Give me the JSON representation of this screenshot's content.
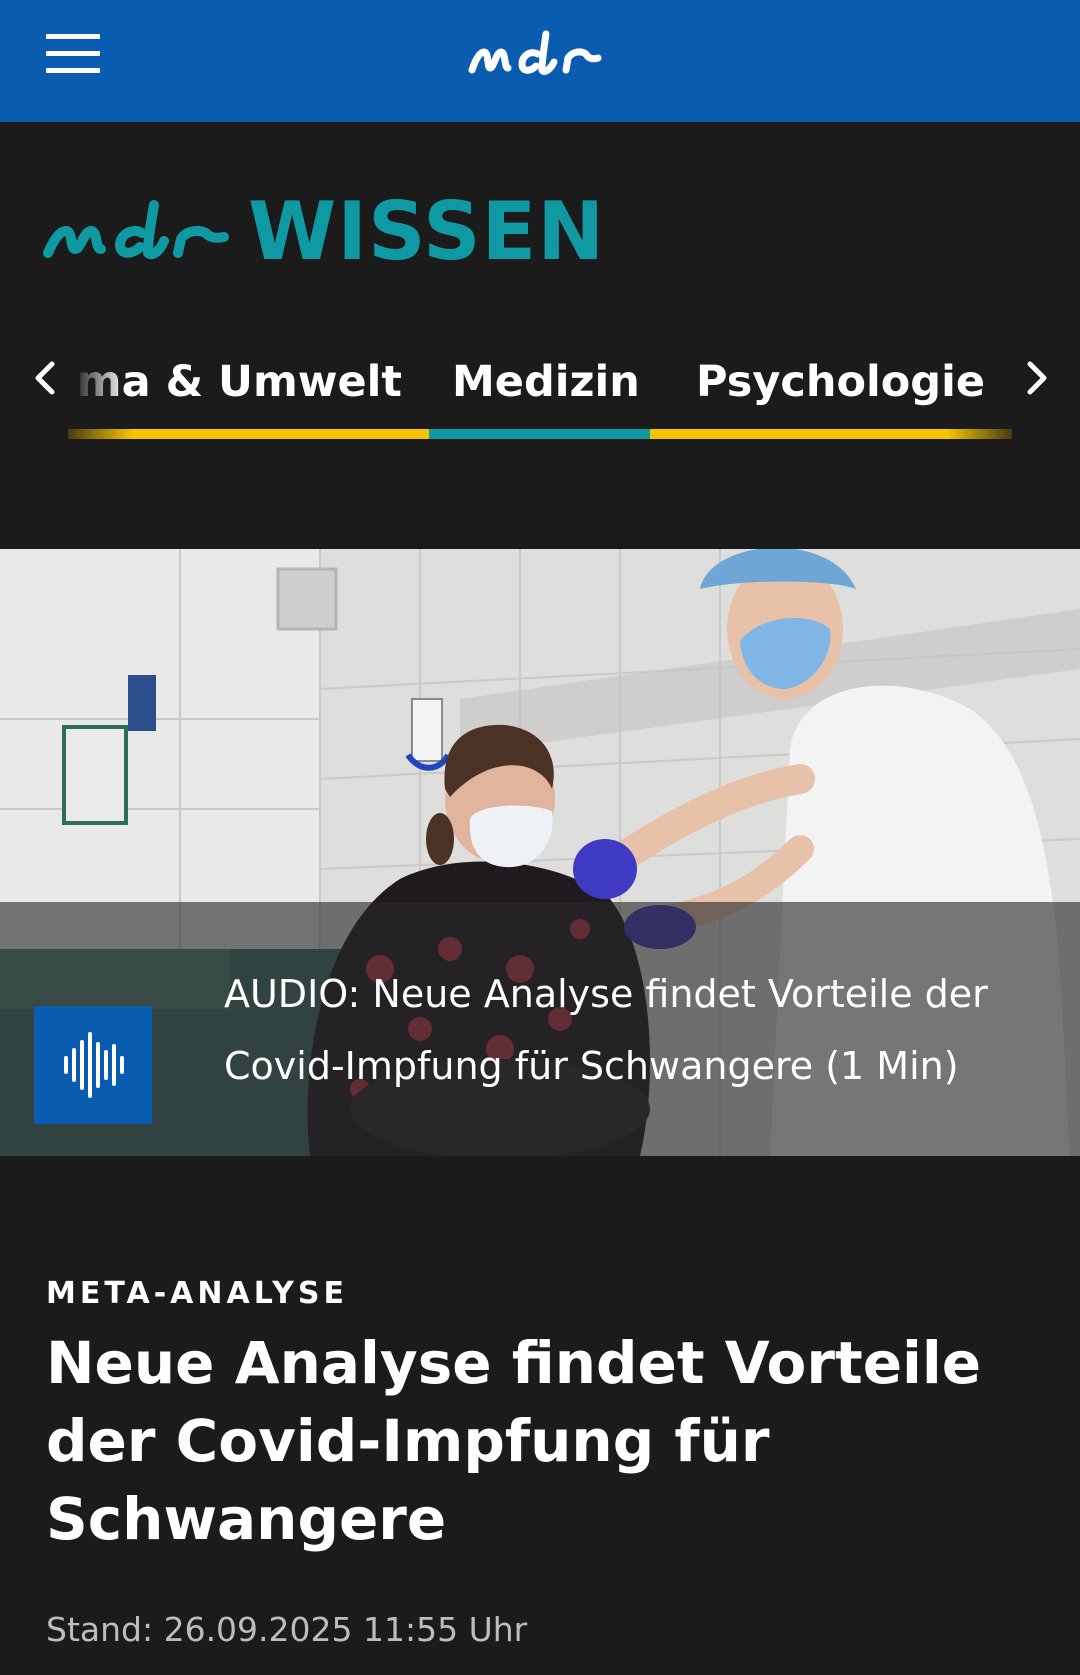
{
  "header": {
    "menu_icon": "hamburger-menu-icon",
    "logo_text": "mdr",
    "bar_color": "#0a5cb0"
  },
  "brand": {
    "logo_text": "mdr",
    "wordmark": "WISSEN",
    "color": "#0f9aa3"
  },
  "nav": {
    "prev_icon": "chevron-left-icon",
    "next_icon": "chevron-right-icon",
    "tabs": [
      {
        "label": "Klima & Umwelt",
        "active": false
      },
      {
        "label": "Medizin",
        "active": true
      },
      {
        "label": "Psychologie",
        "active": false
      }
    ],
    "active_color": "#0f9aa3",
    "inactive_color": "#f5c400"
  },
  "hero": {
    "audio_icon": "audio-waveform-icon",
    "audio_caption": "AUDIO: Neue Analyse findet Vorteile der Covid-Impfung für Schwangere (1 Min)"
  },
  "article": {
    "kicker": "META-ANALYSE",
    "headline": "Neue Analyse findet Vorteile der Covid-Impfung für Schwangere",
    "timestamp": "Stand: 26.09.2025 11:55 Uhr"
  }
}
